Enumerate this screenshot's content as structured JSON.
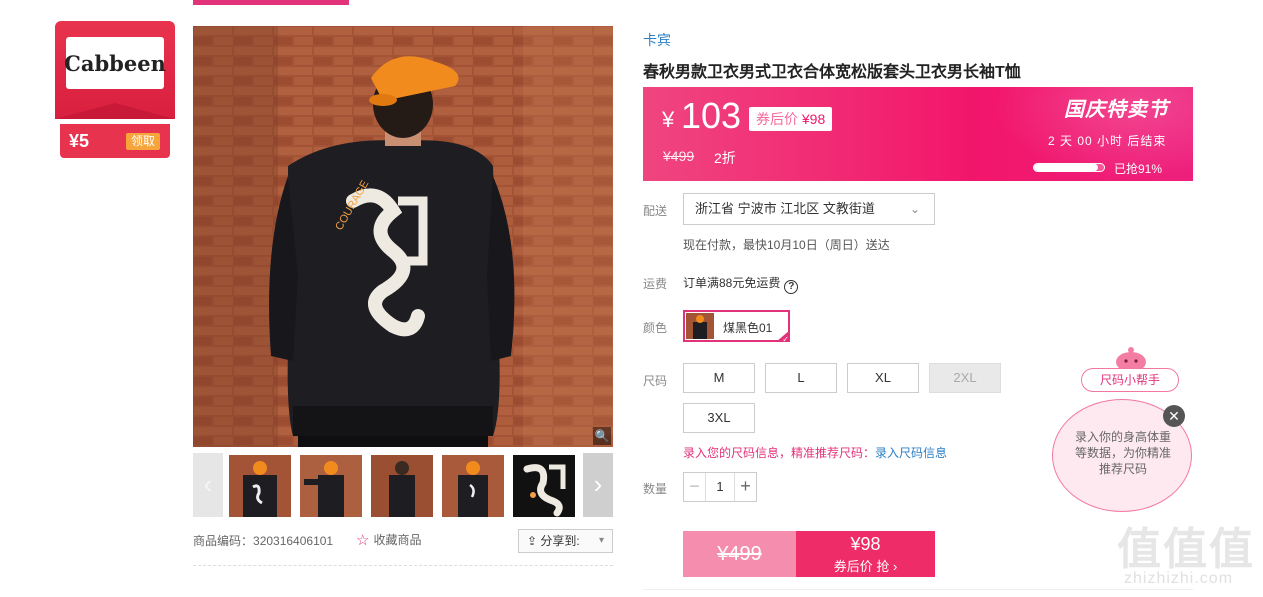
{
  "coupon": {
    "logo_text": "Cabbeen",
    "value": "¥5",
    "claim_label": "领取"
  },
  "gallery": {
    "zoom_glyph": "🔍",
    "prev_glyph": "‹",
    "next_glyph": "›",
    "thumbs": [
      "thumb-1",
      "thumb-2",
      "thumb-3",
      "thumb-4",
      "thumb-5"
    ],
    "selected_thumb": 1,
    "hoodie_print_text": "COURAGE"
  },
  "meta": {
    "sku_label": "商品编码：",
    "sku_value": "320316406101",
    "favorite_label": "收藏商品",
    "share_label": "分享到:",
    "share_caret": "▾"
  },
  "product": {
    "brand": "卡宾",
    "title": "春秋男款卫衣男式卫衣合体宽松版套头卫衣男长袖T恤"
  },
  "price": {
    "currency": "¥",
    "current": "103",
    "after_coupon_label": "券后价",
    "after_coupon_value": "¥98",
    "original": "¥499",
    "discount": "2折",
    "event_name": "国庆特卖节",
    "countdown": "2 天 00 小时 后结束",
    "sold_percent": 91,
    "sold_label": "已抢91%"
  },
  "delivery": {
    "label": "配送",
    "address": "浙江省 宁波市 江北区 文教街道",
    "note": "现在付款，最快10月10日（周日）送达"
  },
  "freight": {
    "label": "运费",
    "text": "订单满88元免运费",
    "help_glyph": "?"
  },
  "color": {
    "label": "颜色",
    "option": "煤黑色01"
  },
  "sizes": {
    "label": "尺码",
    "options": [
      {
        "label": "M",
        "available": true
      },
      {
        "label": "L",
        "available": true
      },
      {
        "label": "XL",
        "available": true
      },
      {
        "label": "2XL",
        "available": false
      },
      {
        "label": "3XL",
        "available": true
      }
    ],
    "hint": "录入您的尺码信息，精准推荐尺码：",
    "hint_link": "录入尺码信息"
  },
  "quantity": {
    "label": "数量",
    "value": "1",
    "minus": "−",
    "plus": "+"
  },
  "buy": {
    "original_price": "¥499",
    "coupon_price": "¥98",
    "coupon_action": "券后价 抢 ›"
  },
  "size_helper": {
    "title": "尺码小帮手",
    "text": "录入你的身高体重等数据，为你精准推荐尺码",
    "close_glyph": "✕"
  },
  "watermark": {
    "big": "值值值",
    "small": "zhizhizhi.com"
  },
  "colors": {
    "accent": "#e2337a",
    "banner": "#f2166b",
    "link": "#2b7fc4",
    "brick": "#a35437"
  }
}
